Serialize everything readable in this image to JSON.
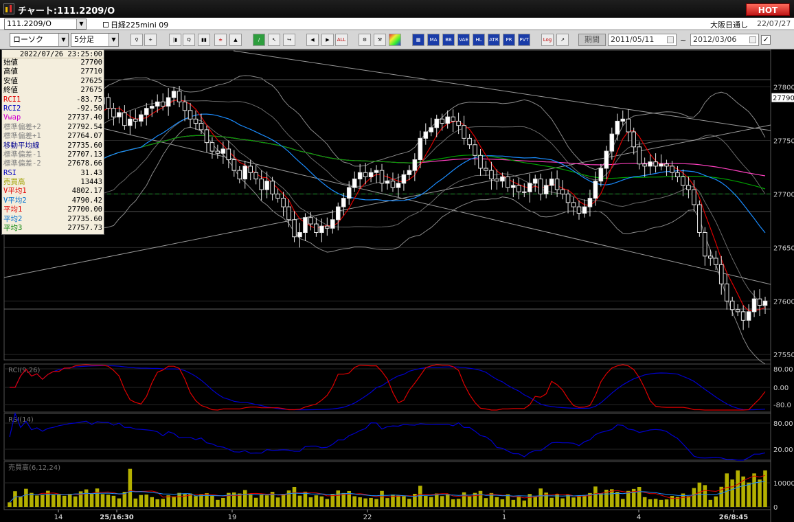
{
  "window": {
    "title": "チャート:111.2209/O",
    "hot_label": "HOT"
  },
  "info_bar": {
    "symbol_code": "111.2209/O",
    "instrument_name": "日経225mini 09",
    "session_label": "大阪日通し",
    "session_date": "22/07/27"
  },
  "toolbar": {
    "chart_type": "ローソク",
    "interval": "5分足",
    "period_label": "期間",
    "date_from": "2011/05/11",
    "date_to": "2012/03/06",
    "range_sep": "~",
    "buttons": [
      "ALL",
      "MA",
      "BB",
      "VAE",
      "HL",
      "ATR",
      "PR",
      "PVT",
      "Log"
    ]
  },
  "data_window": {
    "datetime": "2022/07/26  23:25:00",
    "rows": [
      {
        "label": "始値",
        "value": "27700",
        "color": "#000000"
      },
      {
        "label": "高値",
        "value": "27710",
        "color": "#000000"
      },
      {
        "label": "安値",
        "value": "27625",
        "color": "#000000"
      },
      {
        "label": "終値",
        "value": "27675",
        "color": "#000000"
      },
      {
        "label": "RCI1",
        "value": "-83.75",
        "color": "#e00000"
      },
      {
        "label": "RCI2",
        "value": "-92.50",
        "color": "#0000c0"
      },
      {
        "label": "Vwap",
        "value": "27737.40",
        "color": "#d000d0"
      },
      {
        "label": "標準偏差+2",
        "value": "27792.54",
        "color": "#808080"
      },
      {
        "label": "標準偏差+1",
        "value": "27764.07",
        "color": "#808080"
      },
      {
        "label": "移動平均線",
        "value": "27735.60",
        "color": "#000090"
      },
      {
        "label": "標準偏差-1",
        "value": "27707.13",
        "color": "#808080"
      },
      {
        "label": "標準偏差-2",
        "value": "27678.66",
        "color": "#808080"
      },
      {
        "label": "RSI",
        "value": "31.43",
        "color": "#0000c0"
      },
      {
        "label": "売買高",
        "value": "13443",
        "color": "#a0a000"
      },
      {
        "label": "V平均1",
        "value": "4802.17",
        "color": "#e00000"
      },
      {
        "label": "V平均2",
        "value": "4790.42",
        "color": "#0070d0"
      },
      {
        "label": "平均1",
        "value": "27700.00",
        "color": "#e00000"
      },
      {
        "label": "平均2",
        "value": "27735.60",
        "color": "#0070d0"
      },
      {
        "label": "平均3",
        "value": "27757.73",
        "color": "#008000"
      }
    ]
  },
  "chart_data": [
    {
      "type": "candlestick",
      "title": "",
      "y_ticks": [
        27550,
        27600,
        27650,
        27700,
        27750,
        27800
      ],
      "ylim": [
        27545,
        27835
      ],
      "current_price": 27790,
      "reference_price": 27700,
      "x_ticks": [
        "14",
        "25/16:30",
        "19",
        "22",
        "1",
        "4",
        "26/8:45"
      ],
      "closes": [
        27688,
        27702,
        27696,
        27712,
        27702,
        27708,
        27702,
        27713,
        27718,
        27728,
        27736,
        27746,
        27752,
        27764,
        27778,
        27770,
        27784,
        27790,
        27780,
        27772,
        27776,
        27764,
        27770,
        27768,
        27774,
        27780,
        27782,
        27786,
        27782,
        27790,
        27796,
        27786,
        27778,
        27770,
        27766,
        27760,
        27748,
        27740,
        27738,
        27742,
        27732,
        27722,
        27714,
        27726,
        27720,
        27714,
        27704,
        27712,
        27700,
        27696,
        27688,
        27676,
        27660,
        27664,
        27678,
        27672,
        27664,
        27670,
        27668,
        27676,
        27688,
        27696,
        27706,
        27714,
        27720,
        27716,
        27720,
        27722,
        27710,
        27712,
        27706,
        27710,
        27718,
        27722,
        27732,
        27752,
        27758,
        27762,
        27770,
        27766,
        27772,
        27768,
        27764,
        27752,
        27746,
        27736,
        27724,
        27722,
        27714,
        27712,
        27716,
        27706,
        27708,
        27702,
        27702,
        27710,
        27714,
        27700,
        27708,
        27714,
        27704,
        27700,
        27692,
        27688,
        27682,
        27688,
        27696,
        27712,
        27724,
        27740,
        27756,
        27768,
        27770,
        27758,
        27744,
        27728,
        27726,
        27730,
        27726,
        27728,
        27726,
        27720,
        27716,
        27708,
        27704,
        27690,
        27664,
        27642,
        27640,
        27634,
        27616,
        27600,
        27592,
        27590,
        27582,
        27590,
        27602,
        27596,
        27600
      ],
      "series": [
        {
          "name": "平均1",
          "color": "#e00000"
        },
        {
          "name": "平均2",
          "color": "#1a8cff"
        },
        {
          "name": "平均3",
          "color": "#00a000"
        },
        {
          "name": "Vwap",
          "color": "#ff40c0"
        }
      ]
    },
    {
      "type": "line",
      "title": "RCI(9,26)",
      "y_ticks": [
        "80.00",
        "0.00",
        "-80.0"
      ],
      "ylim": [
        -100,
        100
      ]
    },
    {
      "type": "line",
      "title": "RSI(14)",
      "y_ticks": [
        "80.00",
        "20.00"
      ],
      "ylim": [
        0,
        100
      ]
    },
    {
      "type": "bar",
      "title": "売買高(6,12,24)",
      "y_ticks": [
        "10000",
        "0"
      ],
      "ylim": [
        0,
        14000
      ]
    }
  ]
}
